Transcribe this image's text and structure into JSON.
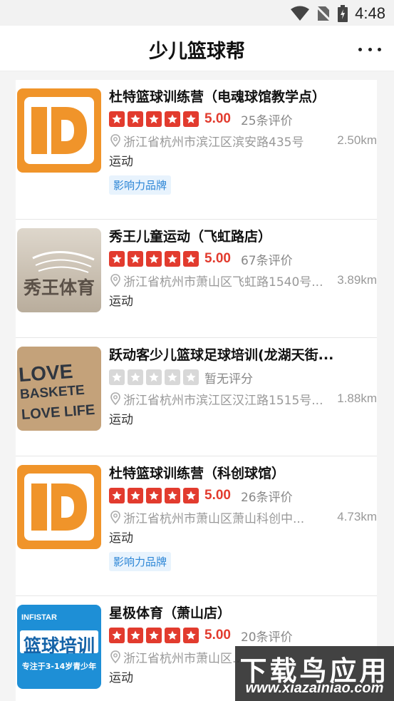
{
  "status_bar": {
    "time": "4:48"
  },
  "header": {
    "title": "少儿篮球帮"
  },
  "colors": {
    "accent_red": "#e23b2e",
    "star_empty": "#d8d8d8",
    "tag_blue": "#2d86d6",
    "logo_orange": "#f0942a"
  },
  "listings": [
    {
      "name": "杜特篮球训练营（电魂球馆教学点）",
      "stars": 5,
      "score": "5.00",
      "reviews": "25条评价",
      "address": "浙江省杭州市滨江区滨安路435号",
      "distance": "2.50km",
      "category": "运动",
      "tag": "影响力品牌",
      "thumb": "d-logo"
    },
    {
      "name": "秀王儿童运动（飞虹路店）",
      "stars": 5,
      "score": "5.00",
      "reviews": "67条评价",
      "address": "浙江省杭州市萧山区飞虹路1540号...",
      "distance": "3.89km",
      "category": "运动",
      "tag": "",
      "thumb": "xiuwang",
      "thumb_text": "秀王体育"
    },
    {
      "name": "跃动客少儿篮球足球培训(龙湖天街...",
      "stars": 0,
      "score": "",
      "reviews": "",
      "no_score": "暂无评分",
      "address": "浙江省杭州市滨江区汉江路1515号...",
      "distance": "1.88km",
      "category": "运动",
      "tag": "",
      "thumb": "love",
      "thumb_lines": [
        "LOVE",
        "BASKETE",
        "LOVE LIFE"
      ]
    },
    {
      "name": "杜特篮球训练营（科创球馆）",
      "stars": 5,
      "score": "5.00",
      "reviews": "26条评价",
      "address": "浙江省杭州市萧山区萧山科创中...",
      "distance": "4.73km",
      "category": "运动",
      "tag": "影响力品牌",
      "thumb": "d-logo"
    },
    {
      "name": "星极体育（萧山店）",
      "stars": 5,
      "score": "5.00",
      "reviews": "20条评价",
      "address": "浙江省杭州市萧山区...",
      "distance": "",
      "category": "运动",
      "tag": "",
      "thumb": "infistar",
      "thumb_text": "篮球培训",
      "thumb_brand": "INFISTAR",
      "thumb_sub": "专注于3-14岁青少年"
    }
  ],
  "watermark": {
    "title": "下载鸟应用",
    "url": "www.xiazainiao.com"
  }
}
